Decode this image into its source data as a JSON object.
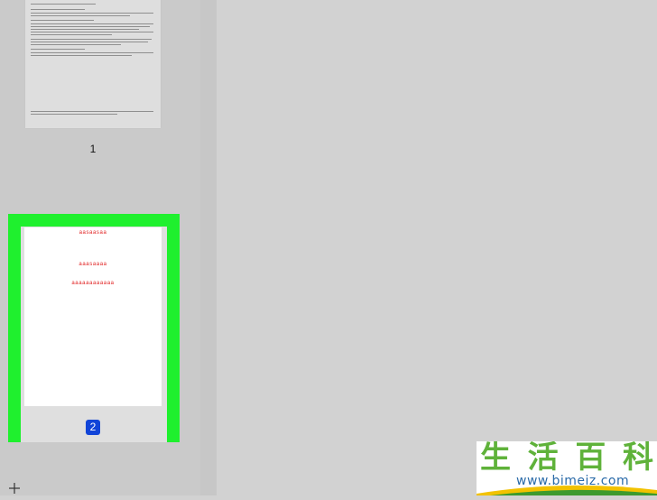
{
  "sidebar": {
    "pages": [
      {
        "number_label": "1",
        "selected": false
      },
      {
        "number_label": "2",
        "selected": true,
        "content_lines": [
          "aasaasaa",
          "aaasaaaa",
          "aaaaaaaaaaaa"
        ]
      }
    ],
    "add_page_icon": "plus-icon"
  },
  "colors": {
    "selection_highlight": "#1ff02e",
    "page_badge": "#1144d8",
    "sample_text": "#e02020"
  },
  "watermark": {
    "chars": [
      "生",
      "活",
      "百",
      "科"
    ],
    "url": "www.bimeiz.com"
  }
}
